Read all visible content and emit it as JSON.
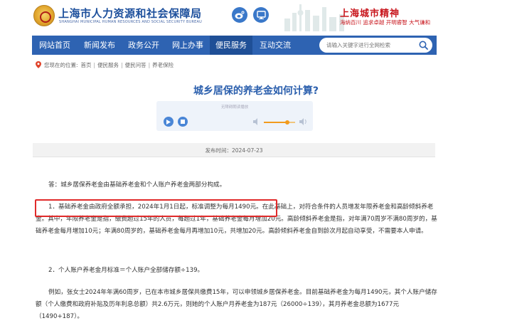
{
  "header": {
    "site_name_cn": "上海市人力资源和社会保障局",
    "site_name_en": "SHANGHAI MUNICIPAL HUMAN RESOURCES AND SOCIAL SECURITY BUREAU",
    "spirit_title": "上海城市精神",
    "spirit_subtitle": "海纳百川 追求卓越 开明睿智 大气谦和"
  },
  "nav": {
    "items": [
      {
        "label": "网站首页"
      },
      {
        "label": "新闻发布"
      },
      {
        "label": "政务公开"
      },
      {
        "label": "网上办事"
      },
      {
        "label": "便民服务"
      },
      {
        "label": "互动交流"
      }
    ],
    "active_label": "便民服务",
    "search_placeholder": "请输入关键字进行全网检索"
  },
  "breadcrumb": {
    "prefix": "您现在的位置:",
    "items": [
      "首页",
      "便民服务",
      "便民问答",
      "养老保险"
    ]
  },
  "article": {
    "title": "城乡居保的养老金如何计算?",
    "player_label": "无障碍朗读播放",
    "volume_level": 0.75,
    "publish_date": "发布时间：2024-07-23",
    "paragraphs": [
      "答：城乡居保养老金由基础养老金和个人账户养老金两部分构成。",
      "1．基础养老金由政府全额承担，2024年1月1日起，标准调整为每月1490元。在此基础上，对符合条件的人员增发年限养老金和高龄倾斜养老金。其中，年限养老金是指，缴费超过15年的人员，每超过1年，基础养老金每月增加20元。高龄倾斜养老金是指，对年满70周岁不满80周岁的，基础养老金每月增加10元；年满80周岁的，基础养老金每月再增加10元，共增加20元。高龄倾斜养老金自到龄次月起自动享受，不需要本人申请。",
      "2．个人账户养老金月标准＝个人账户全部储存额÷139。",
      "例如，张女士2024年年满60周岁，已在本市城乡居保共缴费15年，可以申领城乡居保养老金。目前基础养老金为每月1490元，其个人账户储存额（个人缴费和政府补贴及历年利息总额）共2.6万元，则她的个人账户月养老金为187元（26000÷139），其月养老金总额为1677元（1490+187）。"
    ]
  },
  "colors": {
    "nav_bg": "#2e63b2",
    "nav_active": "#1f4f96",
    "title_blue": "#2b5fad",
    "highlight_red": "#e02a2a",
    "spirit_red": "#c8161d"
  },
  "icons": [
    "emblem-icon",
    "weibo-icon",
    "wechat-icon",
    "search-icon",
    "location-pin-icon",
    "play-icon",
    "stop-icon",
    "volume-low-icon",
    "volume-high-icon"
  ]
}
